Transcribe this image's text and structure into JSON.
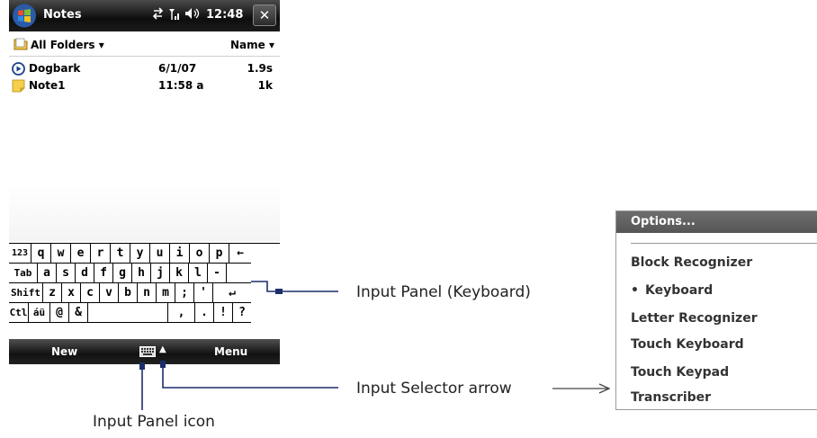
{
  "titlebar": {
    "app_title": "Notes",
    "status_icons": "⇄ ᵀᵢₗ ◂(",
    "time": "12:48",
    "close_label": "✕"
  },
  "toolbar": {
    "folder_label": "All Folders ▾",
    "sort_label": "Name ▾"
  },
  "notes": [
    {
      "name": "Dogbark",
      "date": "6/1/07",
      "size": "1.9s",
      "icon": "voice-note-icon"
    },
    {
      "name": "Note1",
      "date": "11:58 a",
      "size": "1k",
      "icon": "note-icon"
    }
  ],
  "keyboard": {
    "row1": [
      "123",
      "q",
      "w",
      "e",
      "r",
      "t",
      "y",
      "u",
      "i",
      "o",
      "p",
      "←"
    ],
    "row2": [
      "Tab",
      "a",
      "s",
      "d",
      "f",
      "g",
      "h",
      "j",
      "k",
      "l",
      "-",
      ""
    ],
    "row3": [
      "Shift",
      "z",
      "x",
      "c",
      "v",
      "b",
      "n",
      "m",
      ";",
      "'",
      "↵"
    ],
    "row4": [
      "Ctl",
      "áü",
      "@",
      "&",
      "",
      ",",
      ".",
      "!",
      "?"
    ]
  },
  "bottombar": {
    "left_label": "New",
    "right_label": "Menu",
    "arrow": "▲"
  },
  "callouts": {
    "input_panel": "Input Panel (Keyboard)",
    "input_selector": "Input Selector arrow",
    "input_panel_icon": "Input Panel icon"
  },
  "options_menu": {
    "header": "Options...",
    "items": [
      "Block Recognizer",
      "Keyboard",
      "Letter Recognizer",
      "Touch Keyboard",
      "Touch Keypad",
      "Transcriber"
    ],
    "selected_bullet": "•"
  },
  "colors": {
    "titlebar": "#1b1b1b",
    "callout_line": "#1c2f6b",
    "options_header": "#606060"
  }
}
